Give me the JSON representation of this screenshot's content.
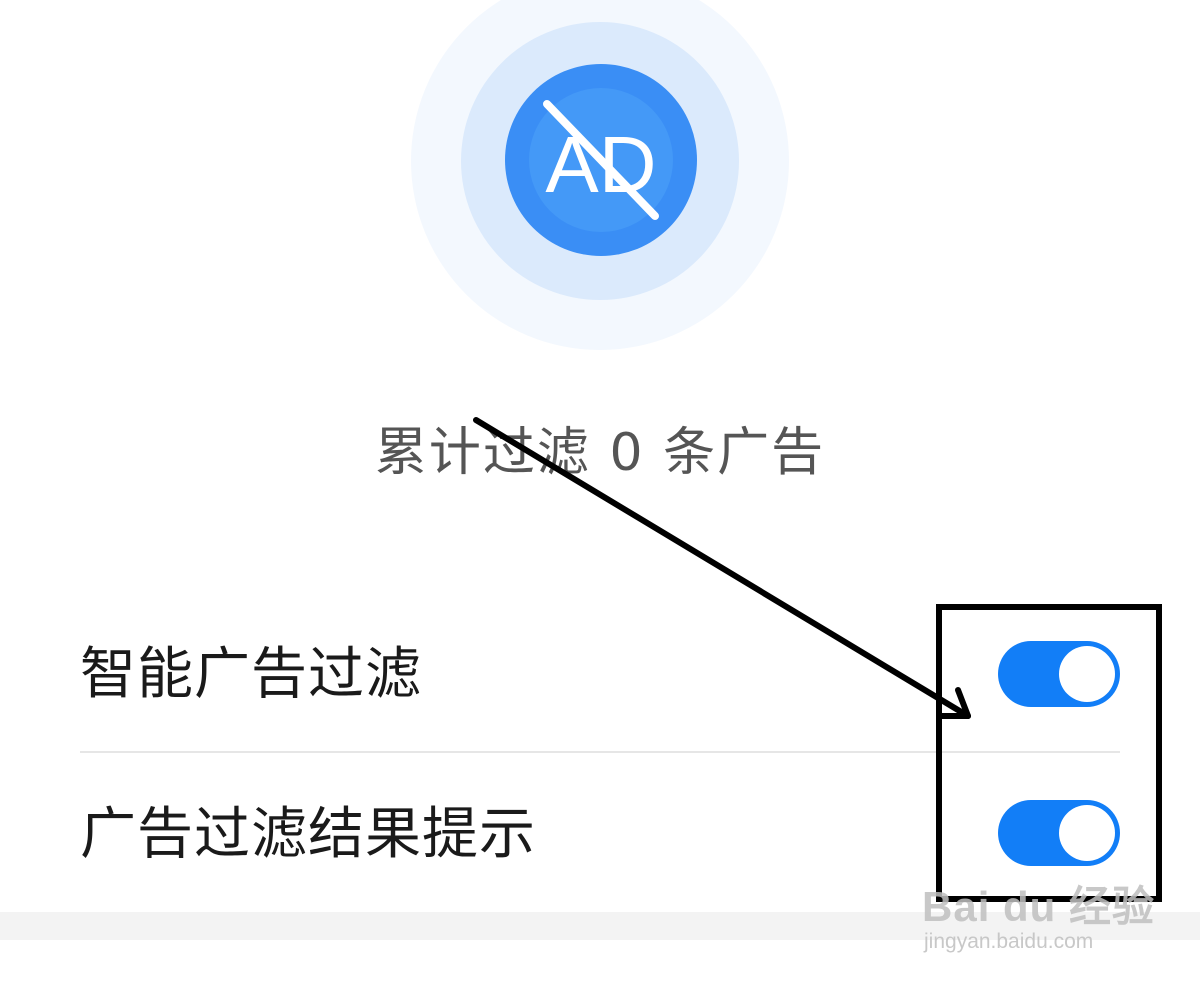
{
  "hero": {
    "icon": "no-ad-icon",
    "badge_text": "AD",
    "colors": {
      "badge": "#3a8ef5",
      "halo_mid": "#dbeafc",
      "halo_outer": "#f3f8fe"
    }
  },
  "stats": {
    "filtered_text": "累计过滤 0 条广告"
  },
  "settings": [
    {
      "label": "智能广告过滤",
      "enabled": true
    },
    {
      "label": "广告过滤结果提示",
      "enabled": true
    }
  ],
  "colors": {
    "toggle_on": "#127ef7",
    "annotation": "#000000"
  },
  "watermark": {
    "logo": "Bai du 经验",
    "url": "jingyan.baidu.com"
  }
}
